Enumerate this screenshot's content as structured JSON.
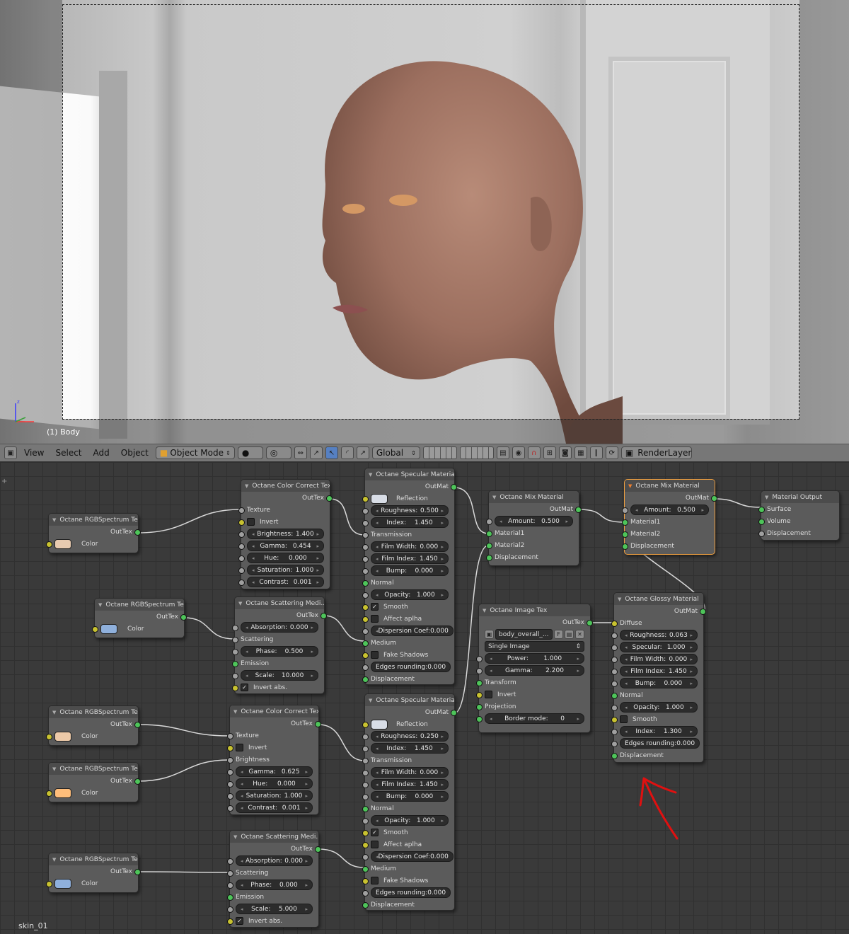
{
  "viewport": {
    "object_label": "(1) Body"
  },
  "header": {
    "menus": [
      "View",
      "Select",
      "Add",
      "Object"
    ],
    "mode": "Object Mode",
    "orientation": "Global",
    "render_layer": "RenderLayer"
  },
  "editor": {
    "material_name": "skin_01"
  },
  "nodes": {
    "rgb1": {
      "title": "Octane RGBSpectrum Te",
      "out": "OutTex",
      "color_label": "Color",
      "swatch": "#e8cbb0"
    },
    "rgb2": {
      "title": "Octane RGBSpectrum Te",
      "out": "OutTex",
      "color_label": "Color",
      "swatch": "#8fb0dc"
    },
    "rgb3": {
      "title": "Octane RGBSpectrum Te",
      "out": "OutTex",
      "color_label": "Color",
      "swatch": "#ecc9a8"
    },
    "rgb4": {
      "title": "Octane RGBSpectrum Te",
      "out": "OutTex",
      "color_label": "Color",
      "swatch": "#ffbe7a"
    },
    "rgb5": {
      "title": "Octane RGBSpectrum Te",
      "out": "OutTex",
      "color_label": "Color",
      "swatch": "#8fb0dc"
    },
    "cc1": {
      "title": "Octane Color Correct Tex",
      "out": "OutTex",
      "texture": "Texture",
      "invert": "Invert",
      "fields": [
        {
          "l": "Brightness:",
          "v": "1.400"
        },
        {
          "l": "Gamma:",
          "v": "0.454"
        },
        {
          "l": "Hue:",
          "v": "0.000"
        },
        {
          "l": "Saturation:",
          "v": "1.000"
        },
        {
          "l": "Contrast:",
          "v": "0.001"
        }
      ]
    },
    "cc2": {
      "title": "Octane Color Correct Tex",
      "out": "OutTex",
      "texture": "Texture",
      "invert": "Invert",
      "brightness": "Brightness",
      "fields": [
        {
          "l": "Gamma:",
          "v": "0.625"
        },
        {
          "l": "Hue:",
          "v": "0.000"
        },
        {
          "l": "Saturation:",
          "v": "1.000"
        },
        {
          "l": "Contrast:",
          "v": "0.001"
        }
      ]
    },
    "scat1": {
      "title": "Octane Scattering Medi...",
      "out": "OutTex",
      "absorption": {
        "l": "Absorption:",
        "v": "0.000"
      },
      "scattering": "Scattering",
      "phase": {
        "l": "Phase:",
        "v": "0.500"
      },
      "emission": "Emission",
      "scale": {
        "l": "Scale:",
        "v": "10.000"
      },
      "invert_abs": "Invert abs."
    },
    "scat2": {
      "title": "Octane Scattering Medi...",
      "out": "OutTex",
      "absorption": {
        "l": "Absorption:",
        "v": "0.000"
      },
      "scattering": "Scattering",
      "phase": {
        "l": "Phase:",
        "v": "0.000"
      },
      "emission": "Emission",
      "scale": {
        "l": "Scale:",
        "v": "5.000"
      },
      "invert_abs": "Invert abs."
    },
    "spec1": {
      "title": "Octane Specular Material",
      "out": "OutMat",
      "reflection": "Reflection",
      "roughness": {
        "l": "Roughness:",
        "v": "0.500"
      },
      "index": {
        "l": "Index:",
        "v": "1.450"
      },
      "transmission": "Transmission",
      "film_width": {
        "l": "Film Width:",
        "v": "0.000"
      },
      "film_index": {
        "l": "Film Index:",
        "v": "1.450"
      },
      "bump": {
        "l": "Bump:",
        "v": "0.000"
      },
      "normal": "Normal",
      "opacity": {
        "l": "Opacity:",
        "v": "1.000"
      },
      "smooth": "Smooth",
      "affect": "Affect aplha",
      "dispersion": {
        "l": "Dispersion Coef:",
        "v": "0.000"
      },
      "medium": "Medium",
      "fake_shadows": "Fake Shadows",
      "edges": {
        "l": "Edges rounding:",
        "v": "0.000"
      },
      "displacement": "Displacement"
    },
    "spec2": {
      "title": "Octane Specular Material",
      "out": "OutMat",
      "reflection": "Reflection",
      "roughness": {
        "l": "Roughness:",
        "v": "0.250"
      },
      "index": {
        "l": "Index:",
        "v": "1.450"
      },
      "transmission": "Transmission",
      "film_width": {
        "l": "Film Width:",
        "v": "0.000"
      },
      "film_index": {
        "l": "Film Index:",
        "v": "1.450"
      },
      "bump": {
        "l": "Bump:",
        "v": "0.000"
      },
      "normal": "Normal",
      "opacity": {
        "l": "Opacity:",
        "v": "1.000"
      },
      "smooth": "Smooth",
      "affect": "Affect aplha",
      "dispersion": {
        "l": "Dispersion Coef:",
        "v": "0.000"
      },
      "medium": "Medium",
      "fake_shadows": "Fake Shadows",
      "edges": {
        "l": "Edges rounding:",
        "v": "0.000"
      },
      "displacement": "Displacement"
    },
    "mix1": {
      "title": "Octane Mix Material",
      "out": "OutMat",
      "amount": {
        "l": "Amount:",
        "v": "0.500"
      },
      "m1": "Material1",
      "m2": "Material2",
      "disp": "Displacement"
    },
    "mix2": {
      "title": "Octane Mix Material",
      "out": "OutMat",
      "amount": {
        "l": "Amount:",
        "v": "0.500"
      },
      "m1": "Material1",
      "m2": "Material2",
      "disp": "Displacement"
    },
    "output": {
      "title": "Material Output",
      "surface": "Surface",
      "volume": "Volume",
      "displacement": "Displacement"
    },
    "img": {
      "title": "Octane Image Tex",
      "out": "OutTex",
      "file": "body_overall_...",
      "f_btn": "F",
      "mode": "Single Image",
      "power": {
        "l": "Power:",
        "v": "1.000"
      },
      "gamma": {
        "l": "Gamma:",
        "v": "2.200"
      },
      "transform": "Transform",
      "invert": "Invert",
      "projection": "Projection",
      "border": {
        "l": "Border mode:",
        "v": "0"
      }
    },
    "glossy": {
      "title": "Octane Glossy Material",
      "out": "OutMat",
      "diffuse": "Diffuse",
      "roughness": {
        "l": "Roughness:",
        "v": "0.063"
      },
      "specular": {
        "l": "Specular:",
        "v": "1.000"
      },
      "film_width": {
        "l": "Film Width:",
        "v": "0.000"
      },
      "film_index": {
        "l": "Film Index:",
        "v": "1.450"
      },
      "bump": {
        "l": "Bump:",
        "v": "0.000"
      },
      "normal": "Normal",
      "opacity": {
        "l": "Opacity:",
        "v": "1.000"
      },
      "smooth": "Smooth",
      "index": {
        "l": "Index:",
        "v": "1.300"
      },
      "edges": {
        "l": "Edges rounding:",
        "v": "0.000"
      },
      "displacement": "Displacement"
    }
  }
}
